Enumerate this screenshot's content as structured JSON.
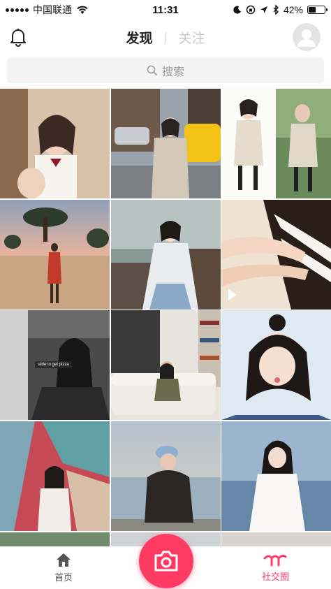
{
  "status_bar": {
    "carrier": "中国联通",
    "time": "11:31",
    "battery": "42%",
    "battery_level": 0.42
  },
  "nav": {
    "tab_discover": "发现",
    "tab_follow": "关注"
  },
  "search": {
    "placeholder": "搜索"
  },
  "feed": {
    "sticker_text": "slide to get pizza"
  },
  "bottom_nav": {
    "home_label": "首页",
    "social_label": "社交圈"
  },
  "colors": {
    "accent": "#ff3b64",
    "active_tab": "#ff3d6a"
  }
}
